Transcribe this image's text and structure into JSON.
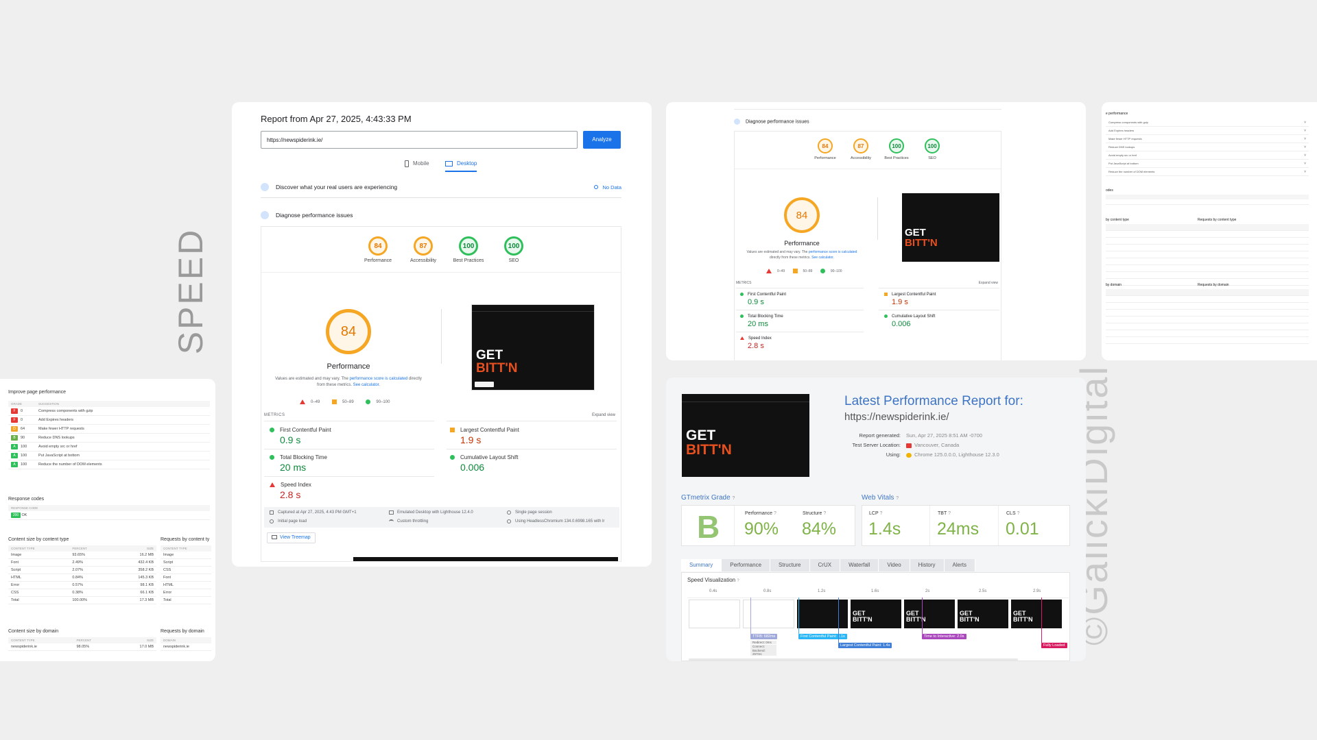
{
  "side_labels": {
    "speed": "SPEED",
    "watermark": "©GalickiDigital"
  },
  "psi": {
    "report_title": "Report from Apr 27, 2025, 4:43:33 PM",
    "url_value": "https://newspiderink.ie/",
    "analyze_label": "Analyze",
    "tabs": [
      {
        "label": "Mobile",
        "selected": false
      },
      {
        "label": "Desktop",
        "selected": true
      }
    ],
    "crux_title": "Discover what your real users are experiencing",
    "crux_nodata": "No Data",
    "diagnose_title": "Diagnose performance issues",
    "gauges": [
      {
        "score": "84",
        "label": "Performance",
        "color": "orange"
      },
      {
        "score": "87",
        "label": "Accessibility",
        "color": "orange"
      },
      {
        "score": "100",
        "label": "Best Practices",
        "color": "green"
      },
      {
        "score": "100",
        "label": "SEO",
        "color": "green"
      }
    ],
    "big_score": "84",
    "big_label": "Performance",
    "note_pre": "Values are estimated and may vary. The ",
    "note_link1": "performance score is calculated",
    "note_mid": " directly from these metrics. ",
    "note_link2": "See calculator.",
    "legend": [
      "0–49",
      "50–89",
      "90–100"
    ],
    "metrics_header": "METRICS",
    "expand_view": "Expand view",
    "metrics": [
      {
        "name": "First Contentful Paint",
        "value": "0.9 s",
        "status": "good"
      },
      {
        "name": "Largest Contentful Paint",
        "value": "1.9 s",
        "status": "average"
      },
      {
        "name": "Total Blocking Time",
        "value": "20 ms",
        "status": "good"
      },
      {
        "name": "Cumulative Layout Shift",
        "value": "0.006",
        "status": "good"
      },
      {
        "name": "Speed Index",
        "value": "2.8 s",
        "status": "poor"
      }
    ],
    "env": [
      "Captured at Apr 27, 2025, 4:43 PM GMT+1",
      "Emulated Desktop with Lighthouse 12.4.0",
      "Single page session",
      "Initial page load",
      "Custom throttling",
      "Using HeadlessChromium 134.0.6998.165 with lr"
    ],
    "treemap": "View Treemap",
    "shot_get": "GET",
    "shot_bit": "BITT'N"
  },
  "yslow": {
    "title": "Improve page performance",
    "cols": [
      "GRADE",
      "SUGGESTION"
    ],
    "rows": [
      {
        "grade": "F",
        "score": "0",
        "text": "Compress components with gzip",
        "color": "#e53935"
      },
      {
        "grade": "F",
        "score": "0",
        "text": "Add Expires headers",
        "color": "#e53935"
      },
      {
        "grade": "D",
        "score": "64",
        "text": "Make fewer HTTP requests",
        "color": "#f0a52b"
      },
      {
        "grade": "B",
        "score": "90",
        "text": "Reduce DNS lookups",
        "color": "#6ab04c"
      },
      {
        "grade": "A",
        "score": "100",
        "text": "Avoid empty src or href",
        "color": "#2fbf5b"
      },
      {
        "grade": "A",
        "score": "100",
        "text": "Put JavaScript at bottom",
        "color": "#2fbf5b"
      },
      {
        "grade": "A",
        "score": "100",
        "text": "Reduce the number of DOM elements",
        "color": "#2fbf5b"
      }
    ],
    "response_title": "Response codes",
    "response_col": "RESPONSE CODE",
    "response_badge": "200",
    "response_ok": "OK",
    "content_title": "Content size by content type",
    "requests_title": "Requests by content ty",
    "content_cols": [
      "CONTENT TYPE",
      "PERCENT",
      "SIZE"
    ],
    "content_rows": [
      {
        "type": "Image",
        "pct": "93.65%",
        "size": "16.2 MB"
      },
      {
        "type": "Font",
        "pct": "2.49%",
        "size": "432.4 KB"
      },
      {
        "type": "Script",
        "pct": "2.07%",
        "size": "358.2 KB"
      },
      {
        "type": "HTML",
        "pct": "0.84%",
        "size": "145.3 KB"
      },
      {
        "type": "Error",
        "pct": "0.57%",
        "size": "98.1 KB"
      },
      {
        "type": "CSS",
        "pct": "0.38%",
        "size": "66.1 KB"
      },
      {
        "type": "Total",
        "pct": "100.00%",
        "size": "17.3 MB"
      }
    ],
    "req_rows": [
      "Image",
      "Script",
      "CSS",
      "Font",
      "HTML",
      "Error",
      "Total"
    ],
    "domain_title": "Content size by domain",
    "domain_req_title": "Requests by domain",
    "domain_cols": [
      "CONTENT TYPE",
      "PERCENT",
      "SIZE"
    ],
    "domain_row": {
      "domain": "newspiderink.ie",
      "pct": "98.05%",
      "size": "17.0 MB"
    },
    "domain_req_row": "newspiderink.ie"
  },
  "gtmetrix": {
    "heading": "Latest Performance Report for:",
    "url": "https://newspiderink.ie/",
    "meta": [
      {
        "label": "Report generated:",
        "value": "Sun, Apr 27, 2025 8:51 AM -0700"
      },
      {
        "label": "Test Server Location:",
        "value": "Vancouver, Canada"
      },
      {
        "label": "Using:",
        "value": "Chrome 125.0.0.0, Lighthouse 12.3.0"
      }
    ],
    "grade_title": "GTmetrix Grade",
    "grade": "B",
    "perf_label": "Performance",
    "perf_value": "90%",
    "struct_label": "Structure",
    "struct_value": "84%",
    "vitals_title": "Web Vitals",
    "vitals": [
      {
        "label": "LCP",
        "value": "1.4s"
      },
      {
        "label": "TBT",
        "value": "24ms"
      },
      {
        "label": "CLS",
        "value": "0.01"
      }
    ],
    "tabs": [
      "Summary",
      "Performance",
      "Structure",
      "CrUX",
      "Waterfall",
      "Video",
      "History",
      "Alerts"
    ],
    "speed_title": "Speed Visualization",
    "ticks": [
      "0.4s",
      "0.8s",
      "1.2s",
      "1.6s",
      "2s",
      "2.5s",
      "2.9s"
    ],
    "markers": [
      {
        "text": "TTFB: 682ms",
        "color": "#9fa8da"
      },
      {
        "text": "First Contentful Paint: 1.1s",
        "color": "#29b6f6"
      },
      {
        "text": "Largest Contentful Paint: 1.4s",
        "color": "#3f7fd8"
      },
      {
        "text": "Time to Interactive: 2.0s",
        "color": "#ab47bc"
      },
      {
        "text": "Fully Loaded",
        "color": "#d81b60"
      }
    ],
    "ttfb_detail": [
      "Redirect: 0ms",
      "Connect: 426ms",
      "Backend: 257ms"
    ],
    "frame_text": "GET BITT'N"
  },
  "right_partial": {
    "title": "e performance",
    "suggestion_rows": [
      "Compress components with gzip",
      "Add Expires headers",
      "Make fewer HTTP requests",
      "Reduce DNS lookups",
      "Avoid empty src or href",
      "Put JavaScript at bottom",
      "Reduce the number of DOM elements"
    ],
    "codes_title": "odes",
    "content_title": "by content type",
    "requests_title": "Requests by content type",
    "domain_title": "by domain",
    "domain_req_title": "Requests by domain"
  }
}
